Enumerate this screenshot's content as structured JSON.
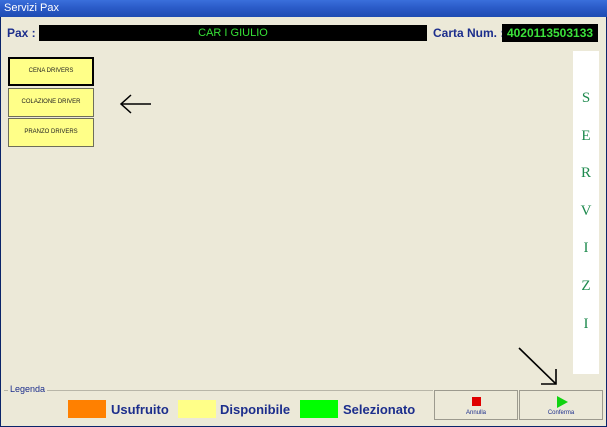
{
  "window": {
    "title": "Servizi Pax"
  },
  "header": {
    "pax_label": "Pax :",
    "pax_value": "CAR I GIULIO",
    "carta_label": "Carta Num. :",
    "carta_value": "4020113503133"
  },
  "services": [
    {
      "label": "CENA DRIVERS"
    },
    {
      "label": "COLAZIONE DRIVER"
    },
    {
      "label": "PRANZO DRIVERS"
    }
  ],
  "side_panel": {
    "letters": [
      "S",
      "E",
      "R",
      "V",
      "I",
      "Z",
      "I"
    ]
  },
  "legend": {
    "title": "Legenda",
    "items": [
      {
        "label": "Usufruito",
        "color": "#FF8000"
      },
      {
        "label": "Disponibile",
        "color": "#FFFF88"
      },
      {
        "label": "Selezionato",
        "color": "#00FF00"
      }
    ]
  },
  "actions": {
    "annulla_label": "Annulla",
    "conferma_label": "Conferma"
  },
  "colors": {
    "title_bar": "#2B5BC8",
    "display_bg": "#000000",
    "display_text": "#36E136",
    "service_button": "#FFFF88",
    "side_letters": "#1E8A4E"
  },
  "icons": {
    "left_arrow": "arrow-left-icon",
    "diag_arrow": "arrow-down-right-icon",
    "stop": "stop-icon",
    "play": "play-icon"
  }
}
